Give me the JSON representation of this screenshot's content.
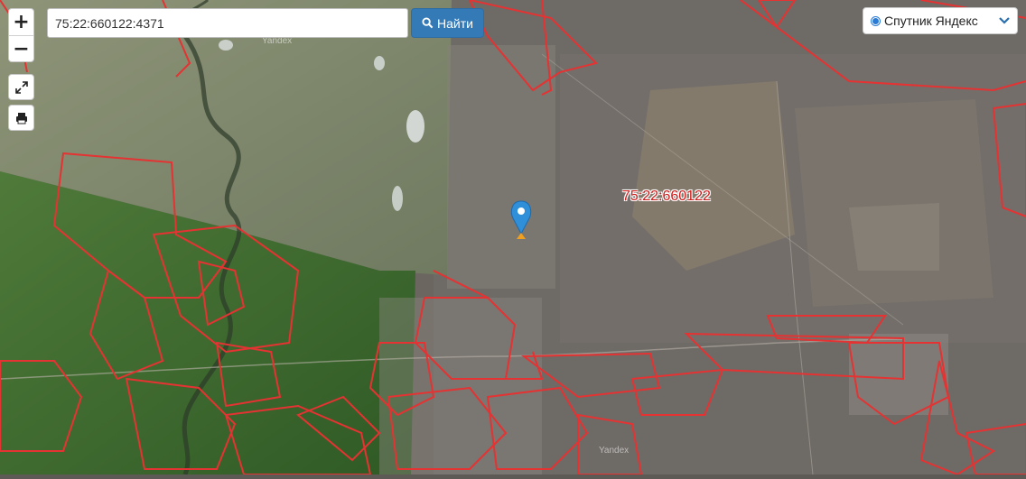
{
  "search": {
    "value": "75:22:660122:4371"
  },
  "toolbar": {
    "find_label": "Найти",
    "find_icon": "search-icon"
  },
  "controls": {
    "zoom_in": "+",
    "zoom_out": "−",
    "fullscreen_icon": "expand-icon",
    "print_icon": "print-icon"
  },
  "layer": {
    "selected": "Спутник Яндекс",
    "icon": "chevron-down-icon"
  },
  "map": {
    "parcel_label": "75:22:660122",
    "watermark": "Yandex",
    "marker_icon": "location-pin-icon",
    "boundary_color": "#e53232",
    "marker_color": "#2f8fd8"
  }
}
